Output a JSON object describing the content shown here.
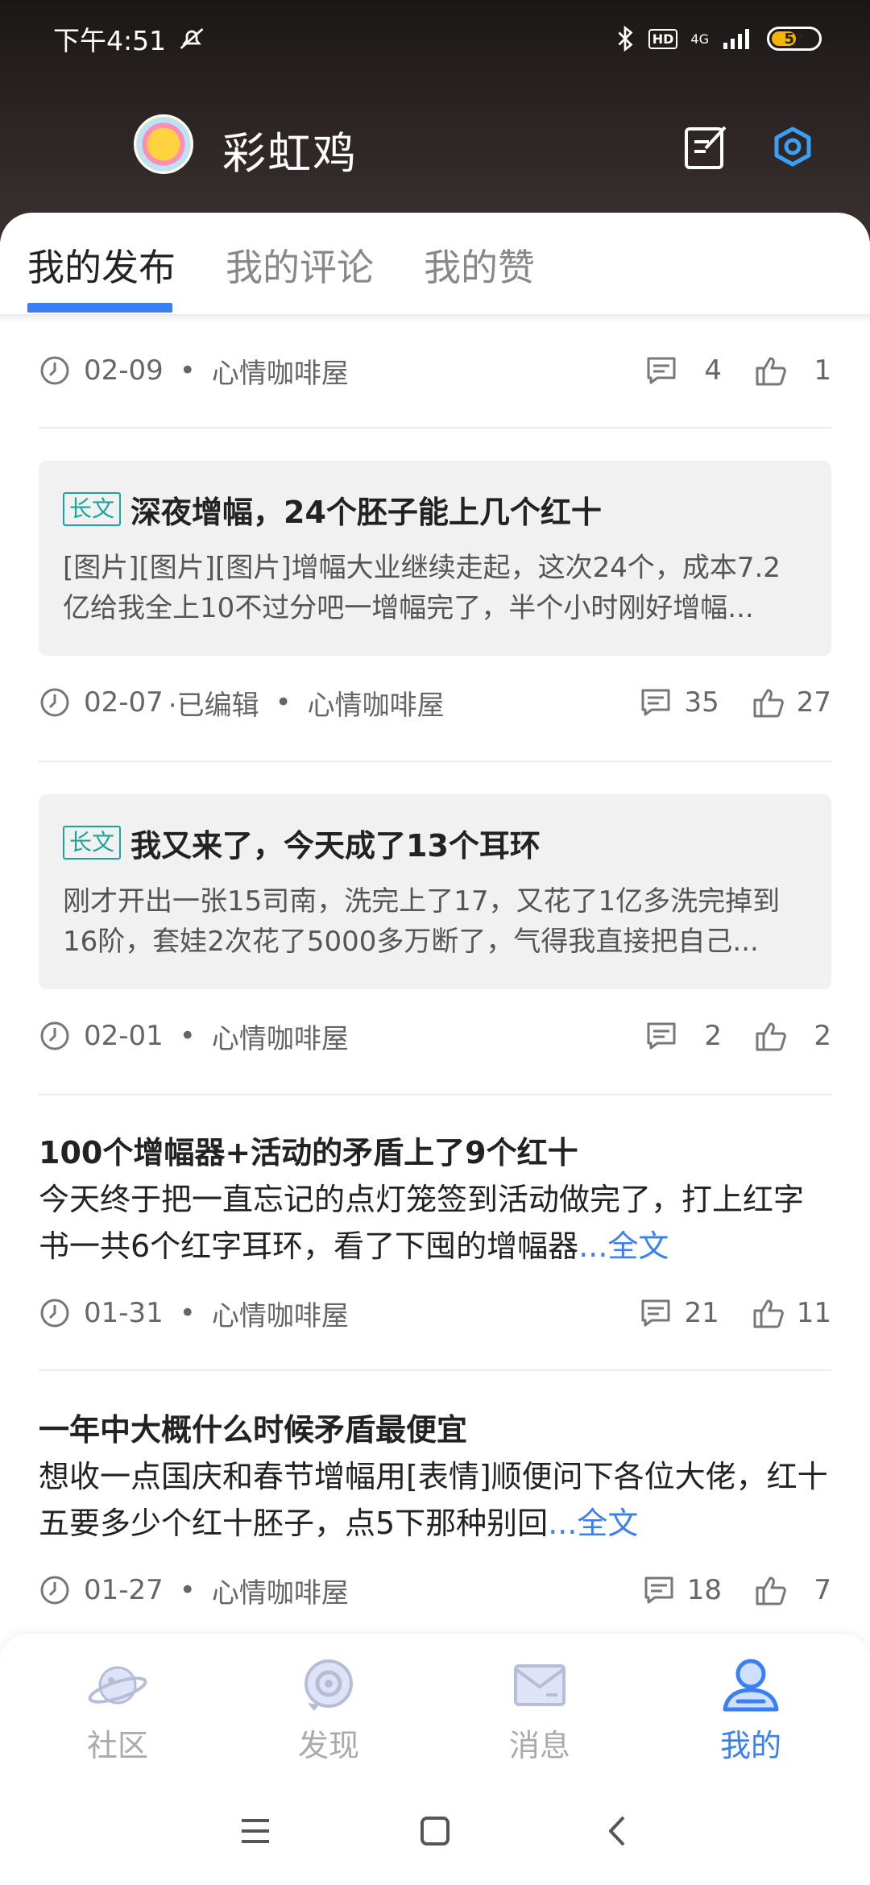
{
  "status_bar": {
    "time": "下午4:51",
    "network": "4G",
    "hd": "HD",
    "battery": "57"
  },
  "profile": {
    "username": "彩虹鸡"
  },
  "tabs": [
    {
      "label": "我的发布"
    },
    {
      "label": "我的评论"
    },
    {
      "label": "我的赞"
    }
  ],
  "posts": [
    {
      "date": "02-09",
      "community": "心情咖啡屋",
      "comments": "4",
      "likes": "1"
    },
    {
      "tag": "长文",
      "title": "深夜增幅，24个胚子能上几个红十",
      "body": "[图片][图片][图片]增幅大业继续走起，这次24个，成本7.2亿给我全上10不过分吧一增幅完了，半个小时刚好增幅...",
      "date": "02-07",
      "edited": "·已编辑",
      "community": "心情咖啡屋",
      "comments": "35",
      "likes": "27"
    },
    {
      "tag": "长文",
      "title": "我又来了，今天成了13个耳环",
      "body": "刚才开出一张15司南，洗完上了17，又花了1亿多洗完掉到16阶，套娃2次花了5000多万断了，气得我直接把自己...",
      "date": "02-01",
      "community": "心情咖啡屋",
      "comments": "2",
      "likes": "2"
    },
    {
      "title": "100个增幅器+活动的矛盾上了9个红十",
      "body": "今天终于把一直忘记的点灯笼签到活动做完了，打上红字书一共6个红字耳环，看了下囤的增幅器",
      "more": "...全文",
      "date": "01-31",
      "community": "心情咖啡屋",
      "comments": "21",
      "likes": "11"
    },
    {
      "title": "一年中大概什么时候矛盾最便宜",
      "body": "想收一点国庆和春节增幅用[表情]顺便问下各位大佬，红十五要多少个红十胚子，点5下那种别回",
      "more": "...全文",
      "date": "01-27",
      "community": "心情咖啡屋",
      "comments": "18",
      "likes": "7"
    }
  ],
  "bottom_nav": [
    {
      "label": "社区",
      "icon": "planet-icon"
    },
    {
      "label": "发现",
      "icon": "discover-icon"
    },
    {
      "label": "消息",
      "icon": "mail-icon"
    },
    {
      "label": "我的",
      "icon": "profile-icon"
    }
  ],
  "colors": {
    "accent": "#3b7ff5",
    "tag": "#1aa59a",
    "header_bg": "#2b2323"
  }
}
